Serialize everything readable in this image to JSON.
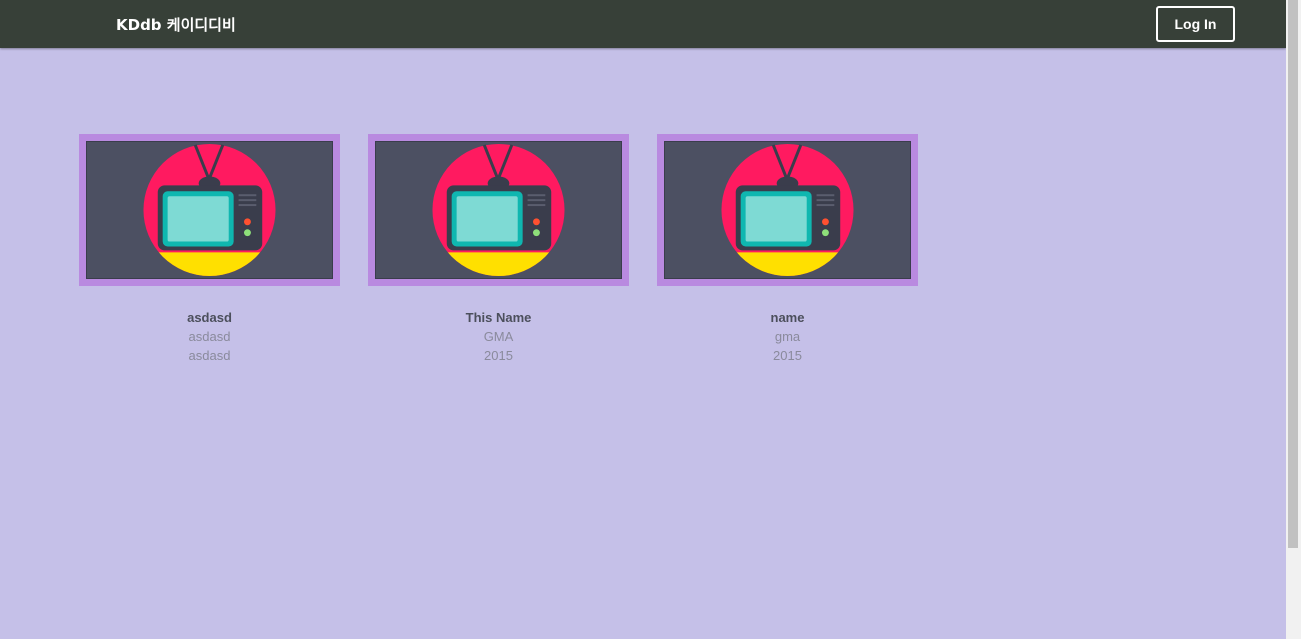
{
  "navbar": {
    "brand": "KDdb 케이디디비",
    "login_label": "Log In"
  },
  "cards": [
    {
      "title": "asdasd",
      "network": "asdasd",
      "year": "asdasd",
      "image_icon": "tv-icon"
    },
    {
      "title": "This Name",
      "network": "GMA",
      "year": "2015",
      "image_icon": "tv-icon"
    },
    {
      "title": "name",
      "network": "gma",
      "year": "2015",
      "image_icon": "tv-icon"
    }
  ],
  "colors": {
    "navbar": "#374038",
    "background": "#c5c0e8",
    "card_frame": "#b98ae0",
    "thumb_bg": "#4c5062"
  }
}
